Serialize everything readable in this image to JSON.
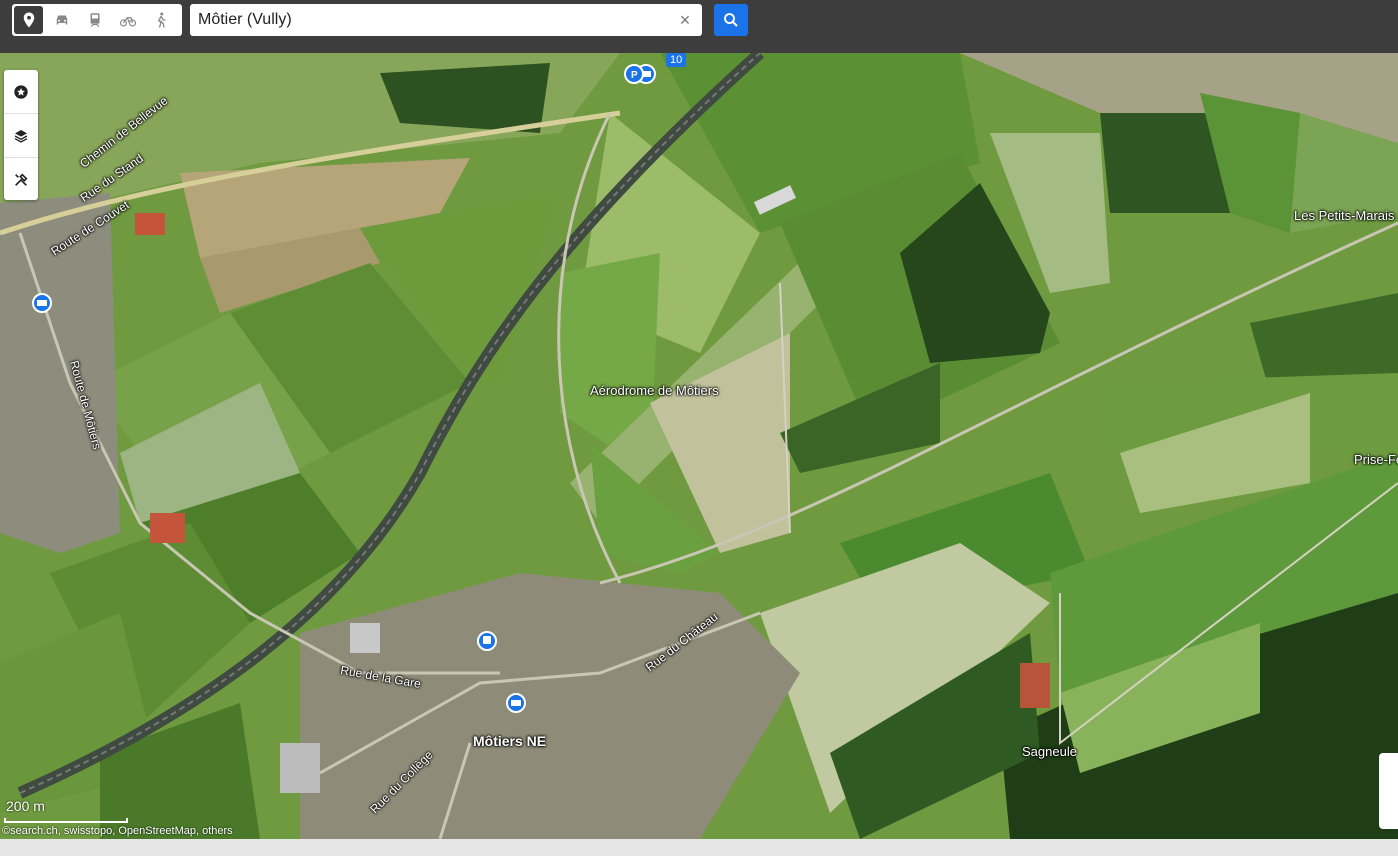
{
  "search": {
    "value": "Môtier (Vully)"
  },
  "modes": [
    {
      "name": "location-pin-icon",
      "active": true
    },
    {
      "name": "car-icon",
      "active": false
    },
    {
      "name": "train-icon",
      "active": false
    },
    {
      "name": "bicycle-icon",
      "active": false
    },
    {
      "name": "walking-icon",
      "active": false
    }
  ],
  "tools": [
    "star-icon",
    "layers-icon",
    "tools-icon"
  ],
  "map": {
    "labels": {
      "chemin_bellevue": "Chemin de Bellevue",
      "rue_stand": "Rue du Stand",
      "route_couvet": "Route de Couvet",
      "route_motiers": "Route de Môtiers",
      "aerodrome": "Aérodrome de Môtiers",
      "petits_marais": "Les Petits-Marais",
      "prise_fe": "Prise-Fe",
      "rue_chateau": "Rue du Château",
      "rue_gare": "Rue de la Gare",
      "motiers_ne": "Môtiers NE",
      "rue_college": "Rue du Collège",
      "sagneule": "Sagneule"
    },
    "road_shield": "10",
    "scale": "200 m",
    "attribution": "©search.ch, swisstopo, OpenStreetMap, others"
  }
}
